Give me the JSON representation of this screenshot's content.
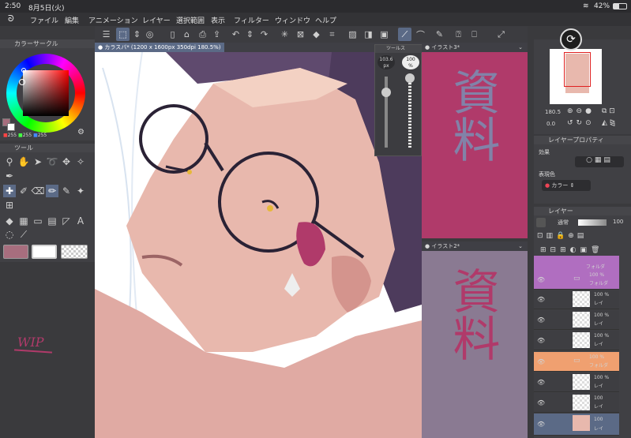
{
  "status": {
    "time": "2:50",
    "date": "8月5日(火)",
    "battery": "42%"
  },
  "menu": [
    "ファイル",
    "編集",
    "アニメーション",
    "レイヤー",
    "選択範囲",
    "表示",
    "フィルター",
    "ウィンドウ",
    "ヘルプ"
  ],
  "color_panel": {
    "title": "カラーサークル",
    "rgb": [
      "255",
      "255",
      "255"
    ]
  },
  "tool_panel": {
    "title": "ツール"
  },
  "canvas": {
    "tab": "カラスバ* (1200 x 1600px 350dpi 180.5%)",
    "wip": "WIP"
  },
  "toolprops": {
    "title": "ツールス",
    "size": "103.6",
    "size_unit": "px",
    "opacity": "100",
    "opacity_unit": "%"
  },
  "sub1": {
    "tab": "イラスト3*",
    "text": "資料"
  },
  "sub2": {
    "tab": "イラスト2*",
    "text": "資料"
  },
  "navigator": {
    "zoom": "180.5",
    "angle": "0.0"
  },
  "layer_props": {
    "title": "レイヤープロパティ",
    "effect": "効果",
    "expr_color": "表現色",
    "color_value": "カラー"
  },
  "layers": {
    "title": "レイヤー",
    "blend": "通常",
    "opacity": "100",
    "rows": [
      {
        "pct": "",
        "name": "フォルダ"
      },
      {
        "pct": "100 %",
        "name": "フォルダ"
      },
      {
        "pct": "100 %",
        "name": "レイ"
      },
      {
        "pct": "100 %",
        "name": "レイ"
      },
      {
        "pct": "100 %",
        "name": "レイ"
      },
      {
        "pct": "100 %",
        "name": "フォルダ"
      },
      {
        "pct": "100 %",
        "name": "レイ"
      },
      {
        "pct": "100",
        "name": "レイ"
      },
      {
        "pct": "100",
        "name": "レイ"
      }
    ]
  },
  "colors": {
    "accent": "#5b6a86",
    "sub1_bg": "#b03a6a",
    "sub2_bg": "#8a7a92",
    "main_swatch": "#a76e7e"
  }
}
